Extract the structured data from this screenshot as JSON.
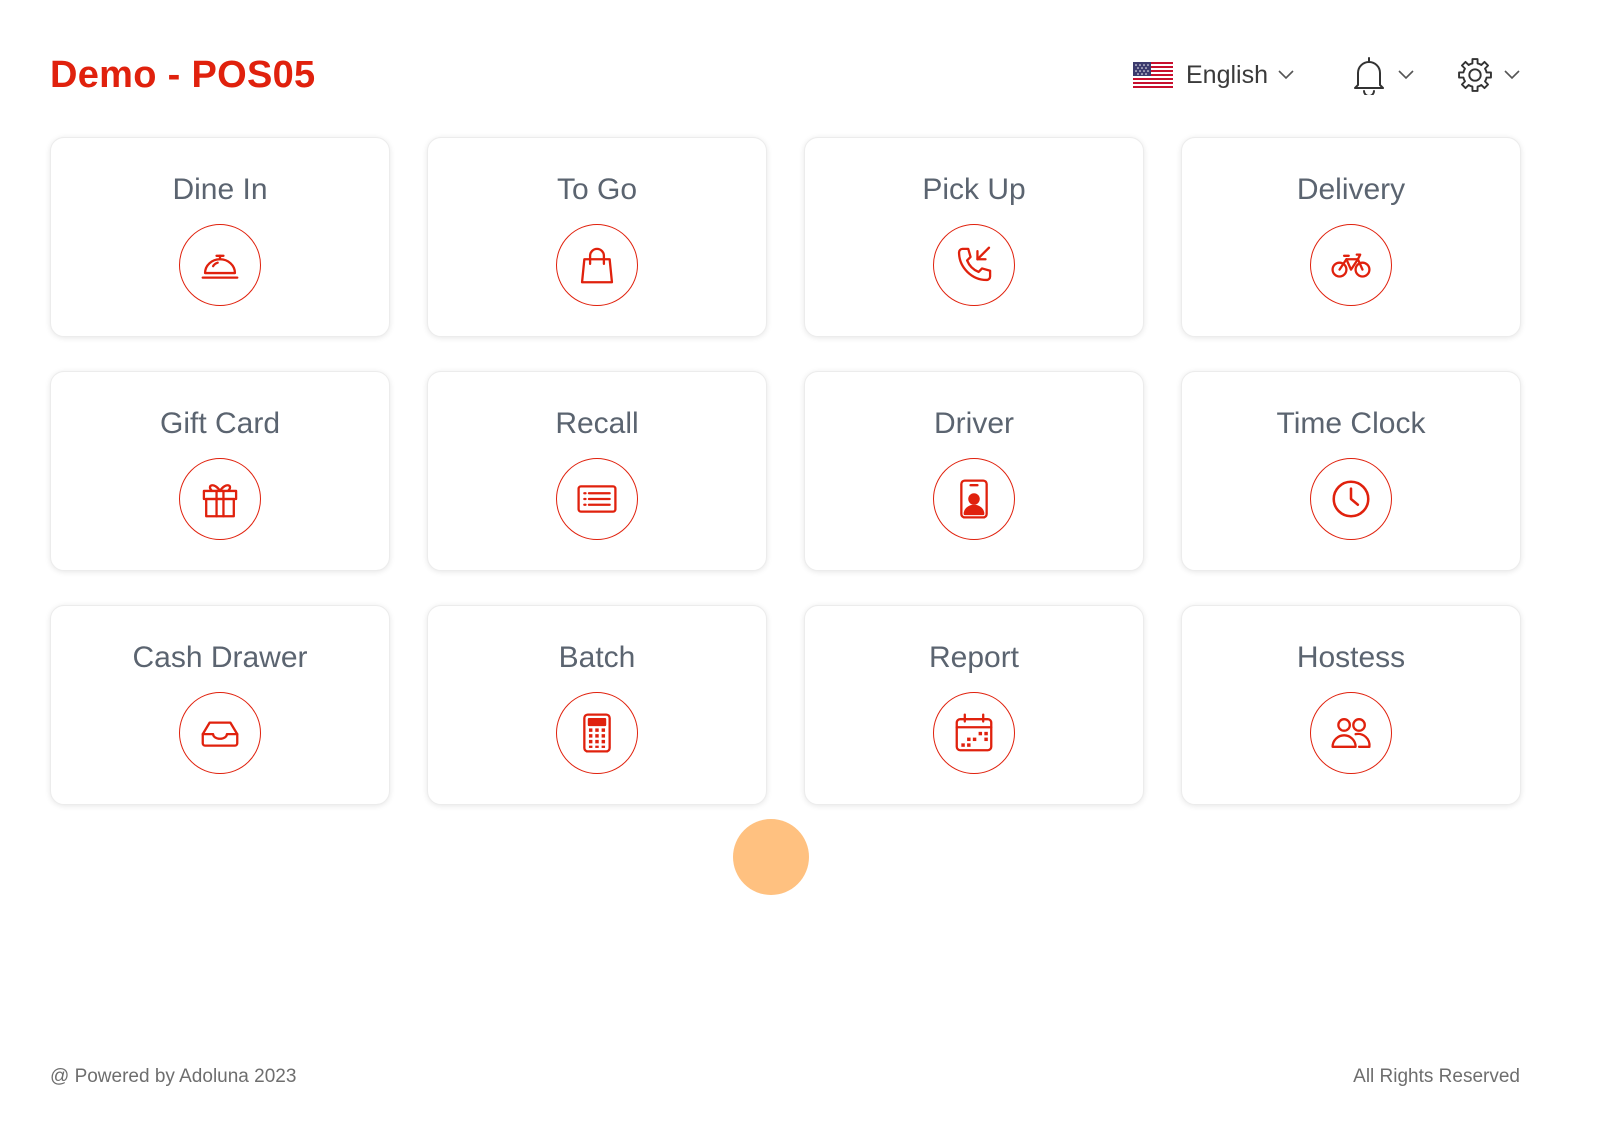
{
  "header": {
    "title": "Demo - POS05",
    "language": {
      "label": "English",
      "flag": "us-flag-icon"
    },
    "notifications_icon": "bell-icon",
    "settings_icon": "gear-icon"
  },
  "tiles": [
    {
      "label": "Dine In",
      "icon": "food-cloche-icon"
    },
    {
      "label": "To Go",
      "icon": "shopping-bag-icon"
    },
    {
      "label": "Pick Up",
      "icon": "phone-incoming-icon"
    },
    {
      "label": "Delivery",
      "icon": "bicycle-icon"
    },
    {
      "label": "Gift Card",
      "icon": "gift-icon"
    },
    {
      "label": "Recall",
      "icon": "list-icon"
    },
    {
      "label": "Driver",
      "icon": "id-badge-icon"
    },
    {
      "label": "Time Clock",
      "icon": "clock-icon"
    },
    {
      "label": "Cash Drawer",
      "icon": "tray-icon"
    },
    {
      "label": "Batch",
      "icon": "calculator-icon"
    },
    {
      "label": "Report",
      "icon": "calendar-icon"
    },
    {
      "label": "Hostess",
      "icon": "people-icon"
    }
  ],
  "footer": {
    "left": "@ Powered by Adoluna 2023",
    "right": "All Rights Reserved"
  },
  "colors": {
    "accent": "#e0210d",
    "tile_label": "#5b6470",
    "cursor_indicator": "#ffc180"
  }
}
